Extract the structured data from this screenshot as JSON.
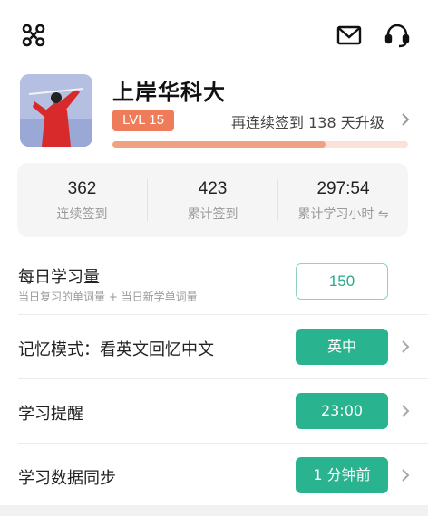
{
  "header": {
    "menu_icon": "grid-menu-icon",
    "mail_icon": "mail-icon",
    "support_icon": "headset-icon"
  },
  "profile": {
    "name": "上岸华科大",
    "level": "LVL 15",
    "upgrade_text": "再连续签到 138 天升级",
    "progress_fraction": 0.72,
    "accent": "#ee7c5b"
  },
  "stats": [
    {
      "value": "362",
      "label": "连续签到"
    },
    {
      "value": "423",
      "label": "累计签到"
    },
    {
      "value": "297:54",
      "label": "累计学习小时 ⇋"
    }
  ],
  "settings": {
    "daily_amount": {
      "title": "每日学习量",
      "subtitle": "当日复习的单词量 + 当日新学单词量",
      "value": "150"
    },
    "memory_mode": {
      "title": "记忆模式：看英文回忆中文",
      "button": "英中"
    },
    "reminder": {
      "title": "学习提醒",
      "button": "23:00"
    },
    "sync": {
      "title": "学习数据同步",
      "button": "1 分钟前"
    }
  },
  "colors": {
    "teal": "#2ab38f",
    "teal_border": "#8fd1c3",
    "badge": "#ee7c5b"
  }
}
